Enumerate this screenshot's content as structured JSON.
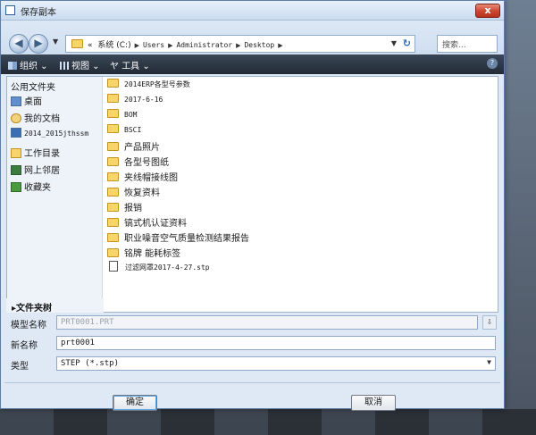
{
  "window": {
    "title": "保存副本",
    "close_label": "x"
  },
  "address": {
    "prefix": "«",
    "crumbs": [
      "系统 (C:)",
      "Users",
      "Administrator",
      "Desktop"
    ],
    "sep": "▶",
    "search_placeholder": "搜索..."
  },
  "toolbar": {
    "organize": "组织 ⌄",
    "view": "视图 ⌄",
    "tools": "工具 ⌄"
  },
  "sidebar": {
    "header": "公用文件夹",
    "items": [
      "桌面",
      "我的文档",
      "2014_2015jthssm",
      "工作目录",
      "网上邻居",
      "收藏夹"
    ]
  },
  "files": [
    {
      "name": "2014ERP各型号参数",
      "kind": "folder"
    },
    {
      "name": "2017-6-16",
      "kind": "folder"
    },
    {
      "name": "BOM",
      "kind": "folder"
    },
    {
      "name": "BSCI",
      "kind": "folder"
    },
    {
      "name": "产品照片",
      "kind": "folder"
    },
    {
      "name": "各型号图纸",
      "kind": "folder"
    },
    {
      "name": "夹线帽接线图",
      "kind": "folder"
    },
    {
      "name": "恢复资料",
      "kind": "folder"
    },
    {
      "name": "报销",
      "kind": "folder"
    },
    {
      "name": "镐式机认证资料",
      "kind": "folder"
    },
    {
      "name": "职业噪音空气质量检测结果报告",
      "kind": "folder"
    },
    {
      "name": "铭牌 能耗标签",
      "kind": "folder"
    },
    {
      "name": "过滤网罩2017-4-27.stp",
      "kind": "file"
    }
  ],
  "tree_label": "▸文件夹树",
  "form": {
    "model_name_label": "模型名称",
    "model_name_value": "PRT0001.PRT",
    "new_name_label": "新名称",
    "new_name_value": "prt0001",
    "type_label": "类型",
    "type_value": "STEP (*.stp)"
  },
  "buttons": {
    "ok": "确定",
    "cancel": "取消"
  },
  "colors": {
    "toolbar_bg": "#2a3440",
    "dialog_bg": "#dfe9f5",
    "close_red": "#c9452f"
  }
}
